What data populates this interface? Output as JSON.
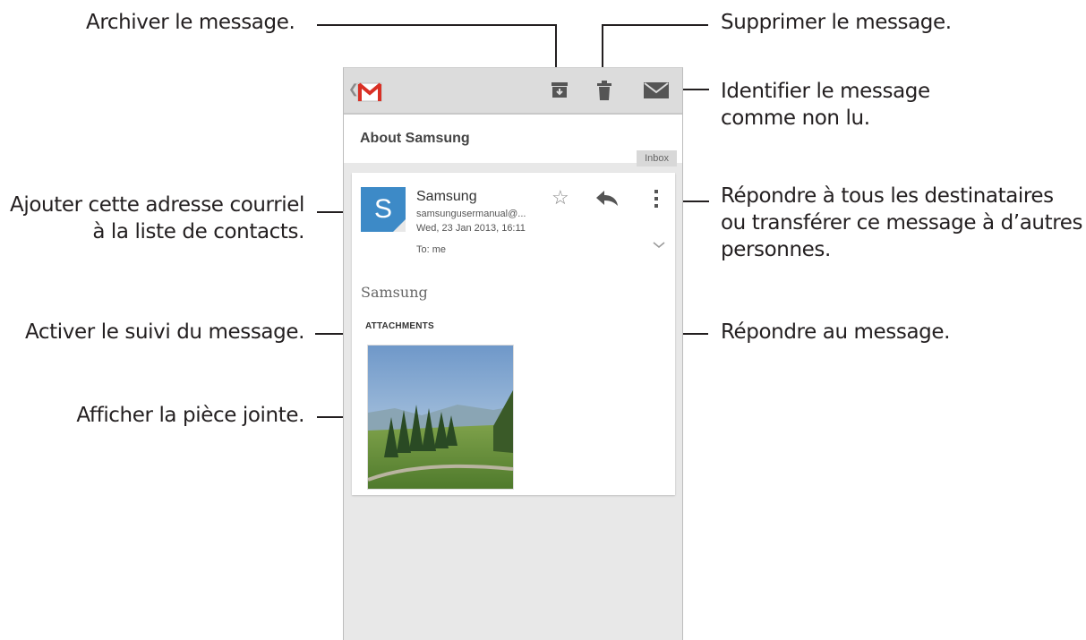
{
  "callouts": {
    "archive": "Archiver le message.",
    "delete": "Supprimer le message.",
    "mark_unread_line1": "Identifier le message",
    "mark_unread_line2": "comme non lu.",
    "add_contact_line1": "Ajouter cette adresse courriel",
    "add_contact_line2": "à la liste de contacts.",
    "more_line1": "Répondre à tous les destinataires",
    "more_line2": "ou transférer ce message à d’autres",
    "more_line3": "personnes.",
    "star": "Activer le suivi du message.",
    "reply": "Répondre au message.",
    "attachment": "Afficher la pièce jointe."
  },
  "email": {
    "subject": "About Samsung",
    "label": "Inbox",
    "avatar_letter": "S",
    "sender": "Samsung",
    "address": "samsungusermanual@...",
    "date": "Wed, 23 Jan 2013, 16:11",
    "to": "To: me",
    "body": "Samsung",
    "attachments_heading": "ATTACHMENTS"
  },
  "colors": {
    "avatar": "#3d8ac7",
    "gmail_red": "#d93025",
    "callout_text": "#231f20"
  },
  "icons": [
    "back-chevron-icon",
    "gmail-icon",
    "archive-icon",
    "trash-icon",
    "envelope-icon",
    "star-icon",
    "reply-icon",
    "overflow-menu-icon",
    "chevron-down-icon"
  ]
}
